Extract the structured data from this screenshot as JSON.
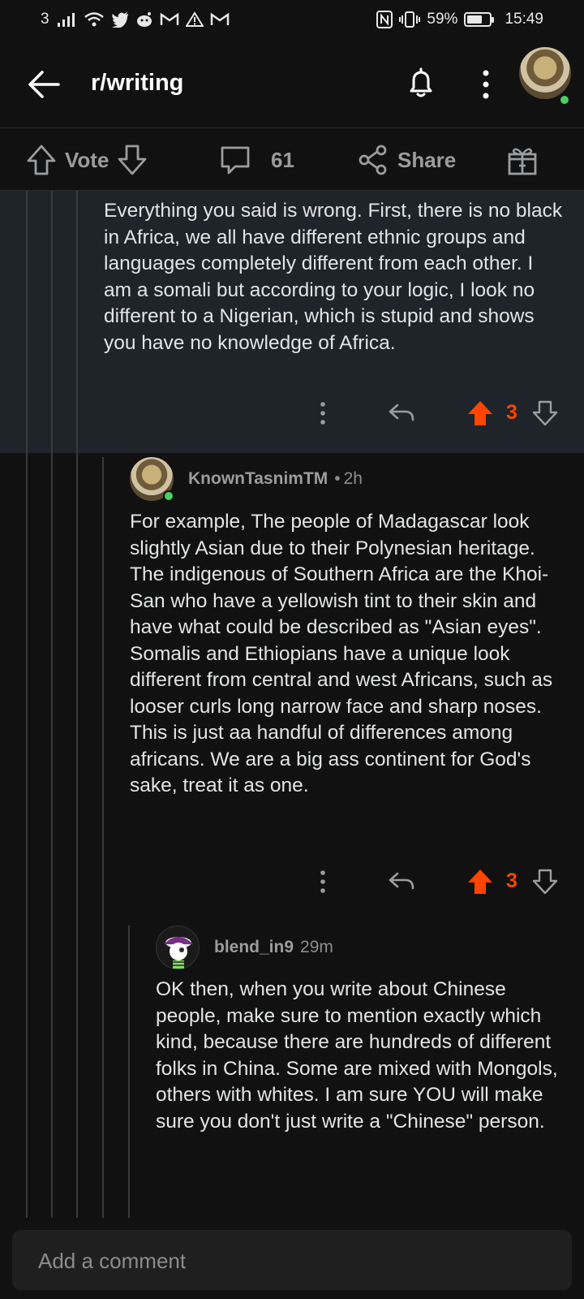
{
  "status_bar": {
    "notif_count": "3",
    "battery": "59%",
    "time": "15:49"
  },
  "header": {
    "title": "r/writing"
  },
  "actions": {
    "vote_label": "Vote",
    "comment_count": "61",
    "share_label": "Share"
  },
  "comments": [
    {
      "text": "Everything you said is wrong. First, there is no black in Africa, we all have different ethnic groups and languages completely different from each other. I am a somali but according to your logic, I look no different to a Nigerian, which is stupid and shows you have no knowledge of Africa.",
      "score": "3",
      "upvoted": true
    },
    {
      "username": "KnownTasnimTM",
      "separator": "•",
      "time": "2h",
      "text": "For example, The people of Madagascar look slightly Asian due to their Polynesian heritage. The indigenous of Southern Africa are the Khoi-San who have a yellowish tint to their skin and have what could be described as \"Asian eyes\". Somalis and Ethiopians have a unique look different from central and west Africans, such as looser curls long narrow face and sharp noses. This is just aa handful of differences among africans. We are a big ass continent for God's sake, treat it as one.",
      "score": "3",
      "upvoted": true
    },
    {
      "username": "blend_in9",
      "time": "29m",
      "text": "OK then, when you write about Chinese people, make sure to mention exactly which kind, because there are hundreds of different folks in China. Some are mixed with Mongols, others with whites. I am sure YOU will make sure you don't just write a \"Chinese\" person."
    }
  ],
  "composer": {
    "placeholder": "Add a comment"
  },
  "colors": {
    "upvote": "#ff4500",
    "online": "#46d160",
    "background": "#111111",
    "highlight": "#1f232a"
  }
}
